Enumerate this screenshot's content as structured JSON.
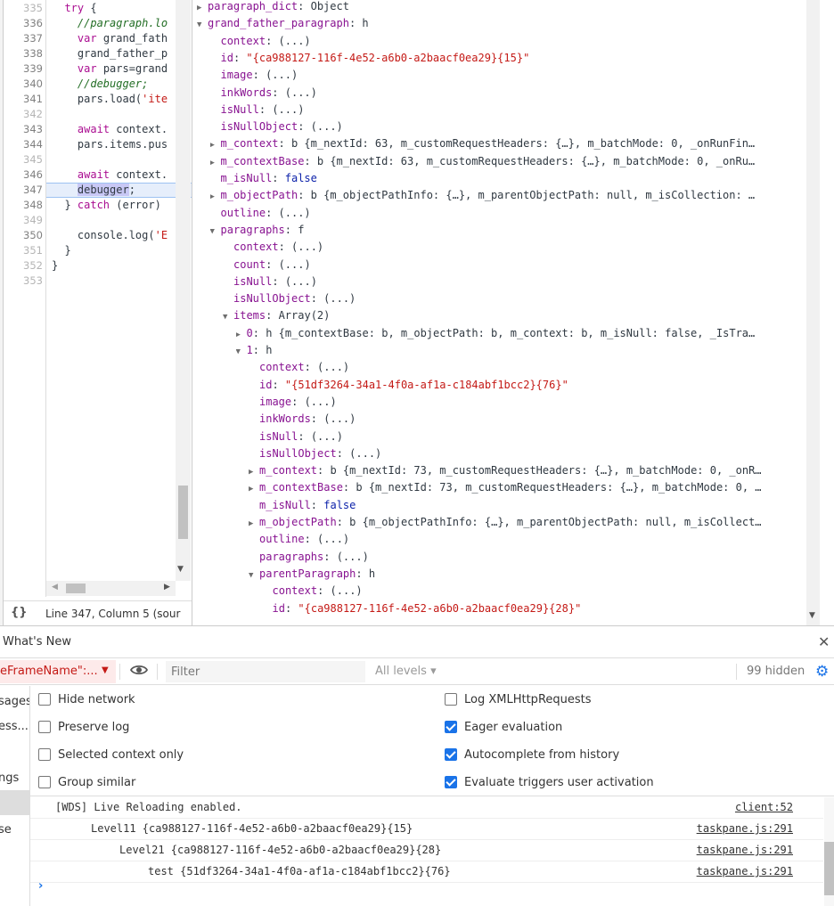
{
  "source": {
    "lines": [
      {
        "n": "335",
        "text": "  try {"
      },
      {
        "n": "336",
        "text": "    //paragraph.lo"
      },
      {
        "n": "337",
        "text": "    var grand_fath"
      },
      {
        "n": "338",
        "text": "    grand_father_p"
      },
      {
        "n": "339",
        "text": "    var pars=grand"
      },
      {
        "n": "340",
        "text": "    //debugger;"
      },
      {
        "n": "341",
        "text": "    pars.load('ite"
      },
      {
        "n": "342",
        "text": ""
      },
      {
        "n": "343",
        "text": "    await context."
      },
      {
        "n": "344",
        "text": "    pars.items.pus"
      },
      {
        "n": "345",
        "text": ""
      },
      {
        "n": "346",
        "text": "    await context."
      },
      {
        "n": "347",
        "text": "    debugger;"
      },
      {
        "n": "348",
        "text": "  } catch (error)"
      },
      {
        "n": "349",
        "text": ""
      },
      {
        "n": "350",
        "text": "    console.log('E"
      },
      {
        "n": "351",
        "text": "  }"
      },
      {
        "n": "352",
        "text": "}"
      },
      {
        "n": "353",
        "text": ""
      }
    ],
    "status": "Line 347, Column 5  (sour",
    "pretty_print": "{}"
  },
  "scope": {
    "rows": [
      {
        "d": 0,
        "t": "c",
        "k": "paragraph_dict",
        "v": "Object",
        "vt": "obj"
      },
      {
        "d": 0,
        "t": "e",
        "k": "grand_father_paragraph",
        "v": "h",
        "vt": "obj"
      },
      {
        "d": 1,
        "t": "",
        "k": "context",
        "v": "(...)",
        "vt": "gray"
      },
      {
        "d": 1,
        "t": "",
        "k": "id",
        "v": "\"{ca988127-116f-4e52-a6b0-a2baacf0ea29}{15}\"",
        "vt": "str"
      },
      {
        "d": 1,
        "t": "",
        "k": "image",
        "v": "(...)",
        "vt": "gray"
      },
      {
        "d": 1,
        "t": "",
        "k": "inkWords",
        "v": "(...)",
        "vt": "gray"
      },
      {
        "d": 1,
        "t": "",
        "k": "isNull",
        "v": "(...)",
        "vt": "gray"
      },
      {
        "d": 1,
        "t": "",
        "k": "isNullObject",
        "v": "(...)",
        "vt": "gray"
      },
      {
        "d": 1,
        "t": "c",
        "k": "m_context",
        "v": "b {m_nextId: 63, m_customRequestHeaders: {…}, m_batchMode: 0, _onRunFin…",
        "vt": "obj"
      },
      {
        "d": 1,
        "t": "c",
        "k": "m_contextBase",
        "v": "b {m_nextId: 63, m_customRequestHeaders: {…}, m_batchMode: 0, _onRu…",
        "vt": "obj"
      },
      {
        "d": 1,
        "t": "",
        "k": "m_isNull",
        "v": "false",
        "vt": "kw"
      },
      {
        "d": 1,
        "t": "c",
        "k": "m_objectPath",
        "v": "b {m_objectPathInfo: {…}, m_parentObjectPath: null, m_isCollection: …",
        "vt": "obj"
      },
      {
        "d": 1,
        "t": "",
        "k": "outline",
        "v": "(...)",
        "vt": "gray"
      },
      {
        "d": 1,
        "t": "e",
        "k": "paragraphs",
        "v": "f",
        "vt": "obj"
      },
      {
        "d": 2,
        "t": "",
        "k": "context",
        "v": "(...)",
        "vt": "gray"
      },
      {
        "d": 2,
        "t": "",
        "k": "count",
        "v": "(...)",
        "vt": "gray"
      },
      {
        "d": 2,
        "t": "",
        "k": "isNull",
        "v": "(...)",
        "vt": "gray"
      },
      {
        "d": 2,
        "t": "",
        "k": "isNullObject",
        "v": "(...)",
        "vt": "gray"
      },
      {
        "d": 2,
        "t": "e",
        "k": "items",
        "v": "Array(2)",
        "vt": "obj"
      },
      {
        "d": 3,
        "t": "c",
        "k": "0",
        "v": "h {m_contextBase: b, m_objectPath: b, m_context: b, m_isNull: false, _IsTra…",
        "vt": "obj"
      },
      {
        "d": 3,
        "t": "e",
        "k": "1",
        "v": "h",
        "vt": "obj"
      },
      {
        "d": 4,
        "t": "",
        "k": "context",
        "v": "(...)",
        "vt": "gray"
      },
      {
        "d": 4,
        "t": "",
        "k": "id",
        "v": "\"{51df3264-34a1-4f0a-af1a-c184abf1bcc2}{76}\"",
        "vt": "str"
      },
      {
        "d": 4,
        "t": "",
        "k": "image",
        "v": "(...)",
        "vt": "gray"
      },
      {
        "d": 4,
        "t": "",
        "k": "inkWords",
        "v": "(...)",
        "vt": "gray"
      },
      {
        "d": 4,
        "t": "",
        "k": "isNull",
        "v": "(...)",
        "vt": "gray"
      },
      {
        "d": 4,
        "t": "",
        "k": "isNullObject",
        "v": "(...)",
        "vt": "gray"
      },
      {
        "d": 4,
        "t": "c",
        "k": "m_context",
        "v": "b {m_nextId: 73, m_customRequestHeaders: {…}, m_batchMode: 0, _onR…",
        "vt": "obj"
      },
      {
        "d": 4,
        "t": "c",
        "k": "m_contextBase",
        "v": "b {m_nextId: 73, m_customRequestHeaders: {…}, m_batchMode: 0, …",
        "vt": "obj"
      },
      {
        "d": 4,
        "t": "",
        "k": "m_isNull",
        "v": "false",
        "vt": "kw"
      },
      {
        "d": 4,
        "t": "c",
        "k": "m_objectPath",
        "v": "b {m_objectPathInfo: {…}, m_parentObjectPath: null, m_isCollect…",
        "vt": "obj"
      },
      {
        "d": 4,
        "t": "",
        "k": "outline",
        "v": "(...)",
        "vt": "gray"
      },
      {
        "d": 4,
        "t": "",
        "k": "paragraphs",
        "v": "(...)",
        "vt": "gray"
      },
      {
        "d": 4,
        "t": "e",
        "k": "parentParagraph",
        "v": "h",
        "vt": "obj"
      },
      {
        "d": 5,
        "t": "",
        "k": "context",
        "v": "(...)",
        "vt": "gray"
      },
      {
        "d": 5,
        "t": "",
        "k": "id",
        "v": "\"{ca988127-116f-4e52-a6b0-a2baacf0ea29}{28}\"",
        "vt": "str"
      }
    ]
  },
  "drawer": {
    "tab_label": "What's New",
    "close_icon": "close-icon"
  },
  "toolbar": {
    "context_label": "eFrameName\":...",
    "filter_placeholder": "Filter",
    "levels_label": "All levels",
    "hidden_count": "99 hidden"
  },
  "settings": {
    "left": [
      {
        "label": "Hide network",
        "checked": false
      },
      {
        "label": "Preserve log",
        "checked": false
      },
      {
        "label": "Selected context only",
        "checked": false
      },
      {
        "label": "Group similar",
        "checked": false
      }
    ],
    "right": [
      {
        "label": "Log XMLHttpRequests",
        "checked": false
      },
      {
        "label": "Eager evaluation",
        "checked": true
      },
      {
        "label": "Autocomplete from history",
        "checked": true
      },
      {
        "label": "Evaluate triggers user activation",
        "checked": true
      }
    ]
  },
  "sidebar": {
    "items": [
      "sages",
      "ess...",
      "ngs",
      "",
      "se"
    ]
  },
  "messages": [
    {
      "text": "[WDS] Live Reloading enabled.",
      "link": "client:52",
      "indent": 0
    },
    {
      "text": "Level11 {ca988127-116f-4e52-a6b0-a2baacf0ea29}{15}",
      "link": "taskpane.js:291",
      "indent": 1
    },
    {
      "text": "Level21 {ca988127-116f-4e52-a6b0-a2baacf0ea29}{28}",
      "link": "taskpane.js:291",
      "indent": 2
    },
    {
      "text": "test {51df3264-34a1-4f0a-af1a-c184abf1bcc2}{76}",
      "link": "taskpane.js:291",
      "indent": 3
    }
  ],
  "colors": {
    "property": "#881391",
    "string": "#c41a16",
    "keyword": "#0d22aa",
    "accent": "#1a73e8"
  }
}
